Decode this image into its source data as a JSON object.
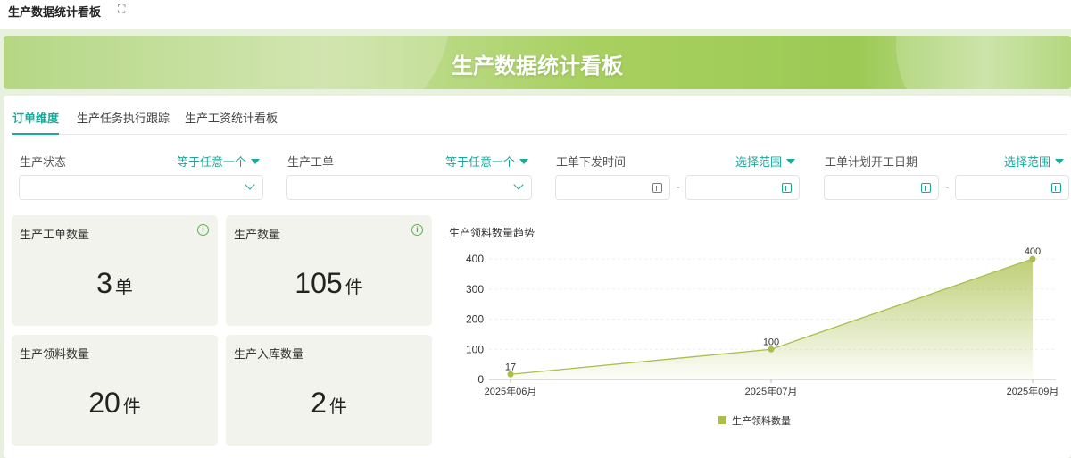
{
  "header": {
    "title": "生产数据统计看板",
    "fullscreen_icon": "expand-icon"
  },
  "banner": {
    "title": "生产数据统计看板"
  },
  "tabs": [
    {
      "label": "订单维度",
      "active": true
    },
    {
      "label": "生产任务执行跟踪"
    },
    {
      "label": "生产工资统计看板"
    }
  ],
  "filters": [
    {
      "label": "生产状态",
      "operator": "等于任意一个"
    },
    {
      "label": "生产工单",
      "operator": "等于任意一个"
    },
    {
      "label": "工单下发时间",
      "operator": "选择范围",
      "sep": "~"
    },
    {
      "label": "工单计划开工日期",
      "operator": "选择范围",
      "sep": "~"
    }
  ],
  "cards": [
    {
      "label": "生产工单数量",
      "value": "3",
      "unit": "单"
    },
    {
      "label": "生产数量",
      "value": "105",
      "unit": "件"
    },
    {
      "label": "生产领料数量",
      "value": "20",
      "unit": "件"
    },
    {
      "label": "生产入库数量",
      "value": "2",
      "unit": "件"
    }
  ],
  "chart_data": {
    "type": "area",
    "title": "生产领料数量趋势",
    "categories": [
      "2025年06月",
      "2025年07月",
      "2025年09月"
    ],
    "series": [
      {
        "name": "生产领料数量",
        "values": [
          17,
          100,
          400
        ],
        "color": "#a9bf4a"
      }
    ],
    "yticks": [
      0,
      100,
      200,
      300,
      400
    ],
    "ylim": [
      0,
      400
    ],
    "legend": "bottom-center",
    "grid": true
  }
}
